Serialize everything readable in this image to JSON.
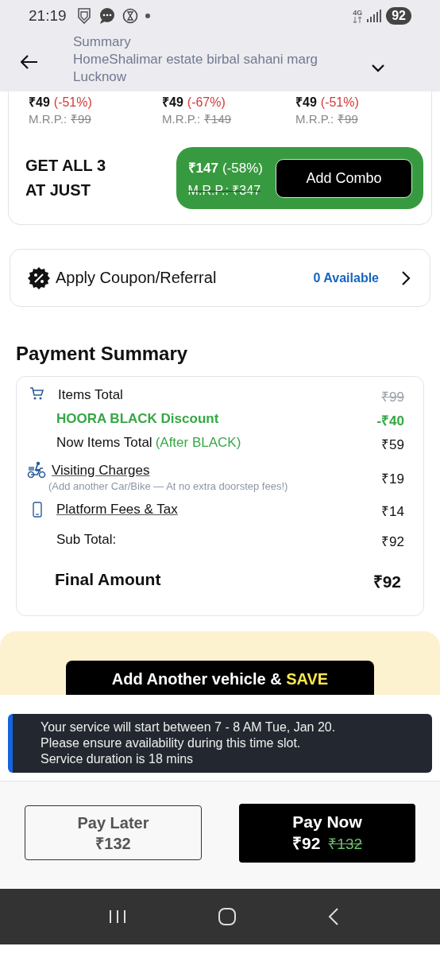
{
  "status_bar": {
    "time": "21:19",
    "network": "4G",
    "battery": "92"
  },
  "header": {
    "title": "Summary",
    "address": "HomeShalimar estate birbal sahani marg Lucknow"
  },
  "products": [
    {
      "price": "₹49",
      "discount": "(-51%)",
      "mrp_label": "M.R.P.:",
      "mrp": "₹99"
    },
    {
      "price": "₹49",
      "discount": "(-67%)",
      "mrp_label": "M.R.P.:",
      "mrp": "₹149"
    },
    {
      "price": "₹49",
      "discount": "(-51%)",
      "mrp_label": "M.R.P.:",
      "mrp": "₹99"
    }
  ],
  "combo": {
    "label": "GET ALL 3 AT JUST",
    "price": "₹147",
    "discount": "(-58%)",
    "mrp": "M.R.P.: ₹347",
    "button": "Add Combo"
  },
  "coupon": {
    "label": "Apply Coupon/Referral",
    "available": "0 Available"
  },
  "payment_summary": {
    "title": "Payment Summary",
    "rows": [
      {
        "kind": "cart",
        "label": "Items Total",
        "value": "₹99",
        "struck": true,
        "link": false
      },
      {
        "kind": "discount",
        "label": "HOORA BLACK Discount",
        "value": "-₹40",
        "struck": false,
        "link": false
      },
      {
        "kind": "plain",
        "label": "Now Items Total",
        "note": "(After BLACK)",
        "value": "₹59",
        "struck": false,
        "link": false
      },
      {
        "kind": "scooter",
        "label": "Visiting Charges",
        "note": "(Add another Car/Bike — At no extra doorstep fees!)",
        "value": "₹19",
        "struck": false,
        "link": true
      },
      {
        "kind": "phone",
        "label": "Platform Fees & Tax",
        "value": "₹14",
        "struck": false,
        "link": true
      },
      {
        "kind": "plain",
        "label": "Sub Total:",
        "value": "₹92",
        "struck": false,
        "link": false
      }
    ],
    "final": {
      "label": "Final Amount",
      "value": "₹92"
    }
  },
  "banner": {
    "text": "Add Another vehicle &",
    "highlight": "SAVE"
  },
  "notice": {
    "lines": [
      "Your service will start between 7 - 8 AM Tue, Jan 20.",
      "Please ensure availability during this time slot.",
      "Service duration is 18 mins"
    ]
  },
  "pay_later": {
    "label": "Pay Later",
    "amount": "₹132"
  },
  "pay_now": {
    "label": "Pay Now",
    "amount": "₹92",
    "mrp": "₹132"
  }
}
